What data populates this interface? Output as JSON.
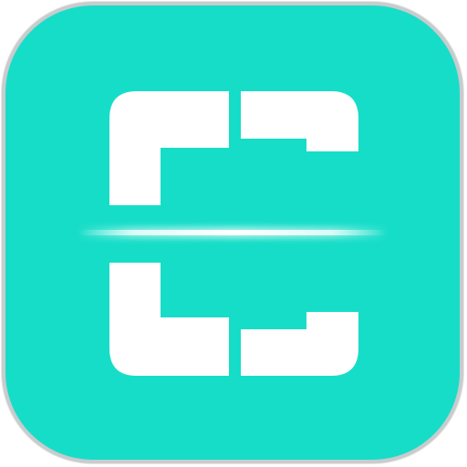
{
  "app_icon": {
    "icon": "scanner-icon",
    "colors": {
      "tile_background": "#16ddc8",
      "glyph": "#ffffff",
      "scan_line": "#ffffff",
      "scan_glow": "#d6fff9",
      "frame_outline": "#c9cbcc"
    }
  }
}
